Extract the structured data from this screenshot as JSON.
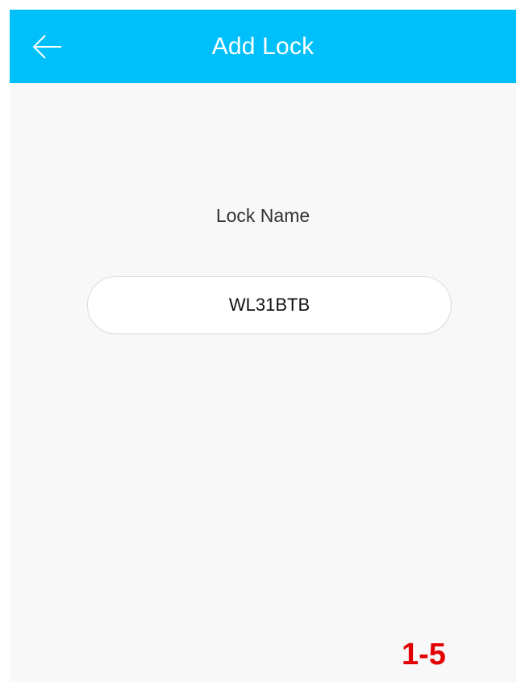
{
  "header": {
    "title": "Add Lock",
    "back_icon": "arrow-left-icon",
    "background_color": "#00c0fb"
  },
  "form": {
    "label": "Lock Name",
    "lock_name_value": "WL31BTB"
  },
  "annotation": {
    "step": "1-5",
    "color": "#e30000"
  }
}
